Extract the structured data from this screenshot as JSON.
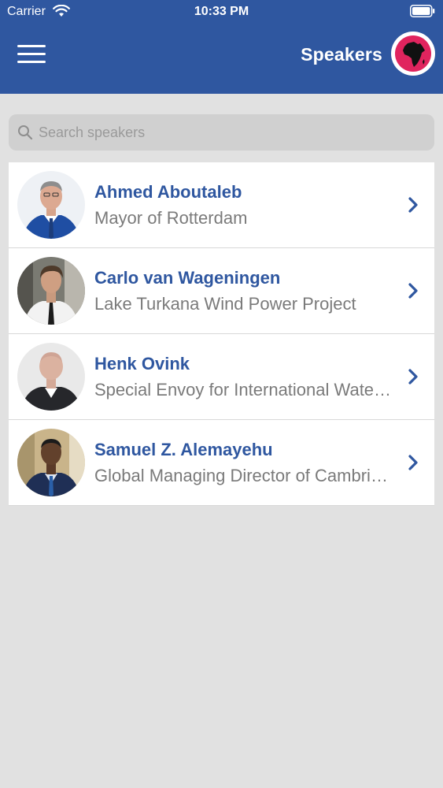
{
  "status_bar": {
    "carrier": "Carrier",
    "time": "10:33 PM"
  },
  "nav": {
    "title": "Speakers",
    "menu_icon": "hamburger-menu-icon",
    "logo_icon": "africa-globe-logo"
  },
  "search": {
    "placeholder": "Search speakers",
    "value": ""
  },
  "speakers": [
    {
      "name": "Ahmed Aboutaleb",
      "role": "Mayor of Rotterdam"
    },
    {
      "name": "Carlo van Wageningen",
      "role": "Lake Turkana Wind Power Project"
    },
    {
      "name": "Henk Ovink",
      "role": "Special Envoy for International Water Affairs"
    },
    {
      "name": "Samuel Z. Alemayehu",
      "role": "Global Managing Director of Cambridge Industries"
    }
  ],
  "colors": {
    "header_bg": "#2f57a0",
    "accent": "#2f57a0",
    "logo_pink": "#e0245e",
    "page_bg": "#e1e1e1"
  }
}
